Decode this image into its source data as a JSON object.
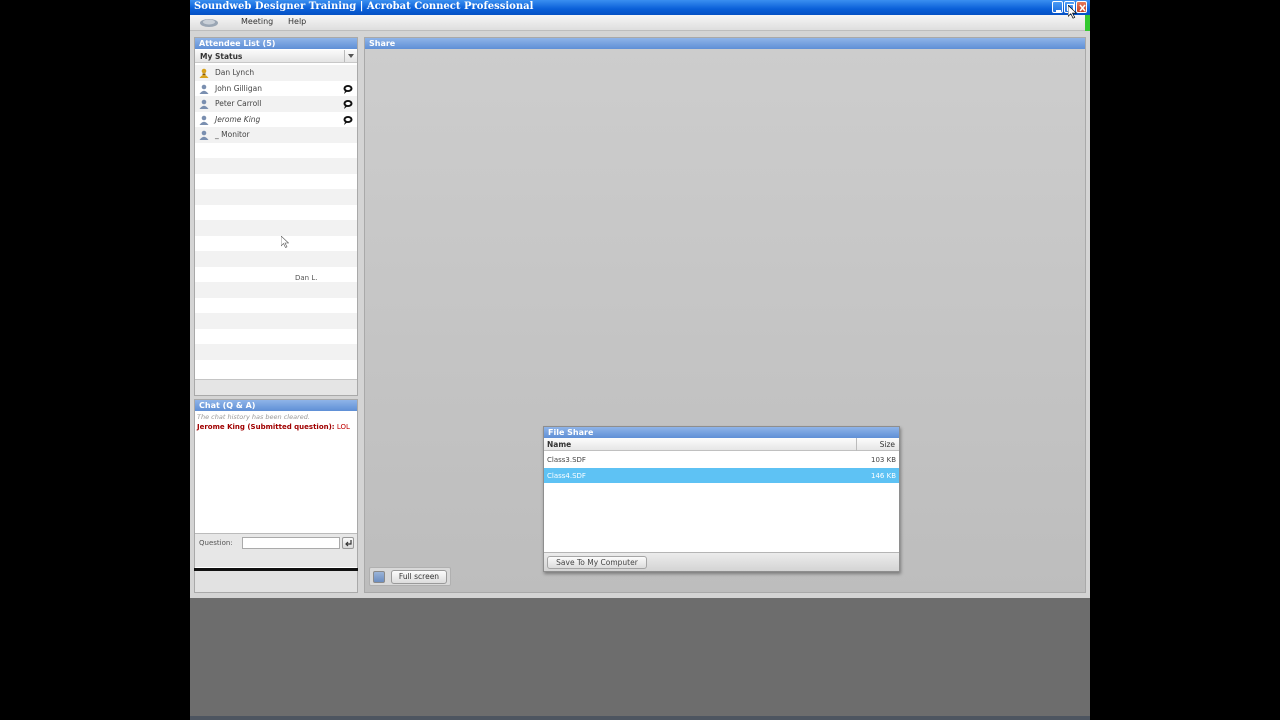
{
  "window": {
    "title": "Soundweb Designer Training | Acrobat Connect Professional"
  },
  "menu": {
    "items": [
      "Meeting",
      "Help"
    ]
  },
  "attendee_panel": {
    "title": "Attendee List (5)",
    "status_label": "My Status",
    "attendees": [
      {
        "name": "Dan Lynch",
        "role": "host",
        "chat_icon": false,
        "italic": false
      },
      {
        "name": "John Gilligan",
        "role": "participant",
        "chat_icon": true,
        "italic": false
      },
      {
        "name": "Peter Carroll",
        "role": "participant",
        "chat_icon": true,
        "italic": false
      },
      {
        "name": "Jerome King",
        "role": "participant",
        "chat_icon": true,
        "italic": true
      },
      {
        "name": "_ Monitor",
        "role": "participant",
        "chat_icon": false,
        "italic": false
      }
    ],
    "cursor_label": "Dan L."
  },
  "chat_panel": {
    "title": "Chat (Q & A)",
    "system_message": "The chat history has been cleared.",
    "messages": [
      {
        "sender": "Jerome King (Submitted question):",
        "text": "LOL"
      }
    ],
    "question_label": "Question:",
    "question_value": ""
  },
  "share_panel": {
    "title": "Share",
    "fullscreen_label": "Full screen"
  },
  "file_share": {
    "title": "File Share",
    "columns": {
      "name": "Name",
      "size": "Size"
    },
    "files": [
      {
        "name": "Class3.SDF",
        "size": "103 KB",
        "selected": false
      },
      {
        "name": "Class4.SDF",
        "size": "146 KB",
        "selected": true
      }
    ],
    "save_button": "Save To My Computer"
  },
  "colors": {
    "title_bar": "#0a5fd8",
    "panel_header": "#5f8fd6",
    "selected_row": "#5ec2f4",
    "chat_sender": "#a00000",
    "status_green": "#34c930"
  }
}
